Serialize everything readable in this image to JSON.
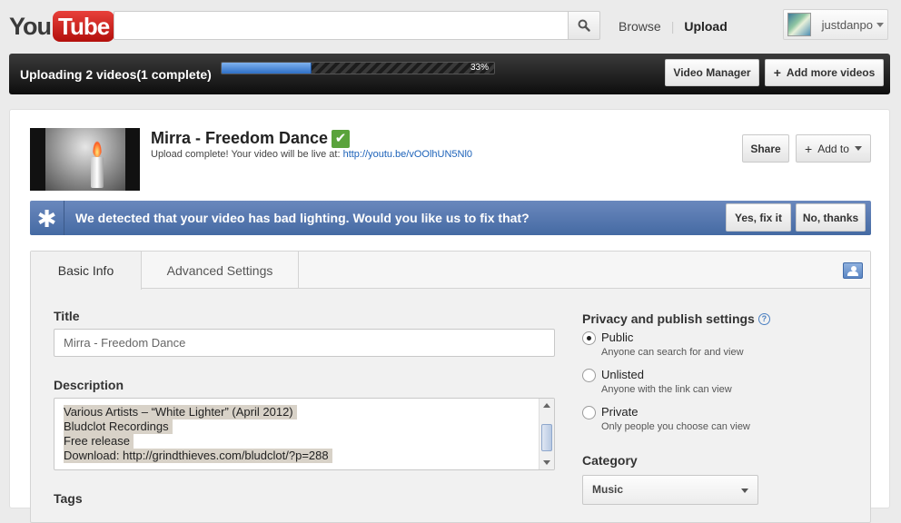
{
  "header": {
    "logo_you": "You",
    "logo_tube": "Tube",
    "search_value": "",
    "browse": "Browse",
    "upload": "Upload",
    "account_name": "justdanpo"
  },
  "upload_bar": {
    "status": "Uploading 2 videos(1 complete)",
    "progress": 0.33,
    "progress_label": "33%",
    "video_manager": "Video Manager",
    "add_more": "Add more videos"
  },
  "video": {
    "title": "Mirra - Freedom Dance",
    "status_text": "Upload complete! Your video will be live at:",
    "url": "http://youtu.be/vOOlhUN5Nl0",
    "share": "Share",
    "add_to": "Add to"
  },
  "banner": {
    "message": "We detected that your video has bad lighting. Would you like us to fix that?",
    "yes": "Yes, fix it",
    "no": "No, thanks"
  },
  "tabs": {
    "basic": "Basic Info",
    "advanced": "Advanced Settings"
  },
  "form": {
    "title_label": "Title",
    "title_value": "Mirra - Freedom Dance",
    "description_label": "Description",
    "description_lines": [
      "Various Artists – “White Lighter” (April 2012)",
      "Bludclot Recordings",
      "Free release",
      "Download: http://grindthieves.com/bludclot/?p=288"
    ],
    "tags_label": "Tags"
  },
  "privacy": {
    "label": "Privacy and publish settings",
    "options": [
      {
        "title": "Public",
        "desc": "Anyone can search for and view",
        "selected": true
      },
      {
        "title": "Unlisted",
        "desc": "Anyone with the link can view",
        "selected": false
      },
      {
        "title": "Private",
        "desc": "Only people you choose can view",
        "selected": false
      }
    ]
  },
  "category": {
    "label": "Category",
    "selected": "Music"
  },
  "colors": {
    "banner_blue": "#5277b0",
    "progress_blue": "#2e6fc6",
    "check_green": "#5aa33b",
    "link_blue": "#1c62b9"
  }
}
